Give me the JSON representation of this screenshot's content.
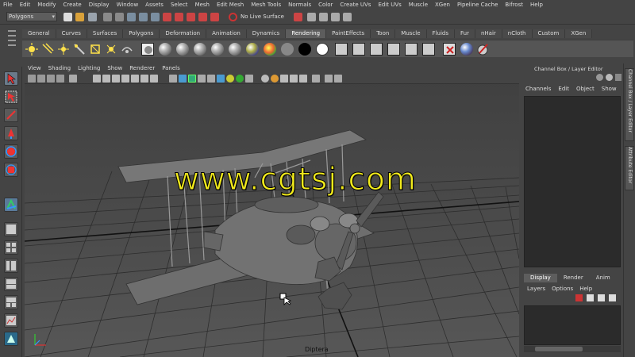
{
  "menu": [
    "File",
    "Edit",
    "Modify",
    "Create",
    "Display",
    "Window",
    "Assets",
    "Select",
    "Mesh",
    "Edit Mesh",
    "Mesh Tools",
    "Normals",
    "Color",
    "Create UVs",
    "Edit UVs",
    "Muscle",
    "XGen",
    "Pipeline Cache",
    "Bifrost",
    "Help"
  ],
  "status": {
    "mode": "Polygons",
    "live_surface": "No Live Surface"
  },
  "shelf": {
    "tabs": [
      "General",
      "Curves",
      "Surfaces",
      "Polygons",
      "Deformation",
      "Animation",
      "Dynamics",
      "Rendering",
      "PaintEffects",
      "Toon",
      "Muscle",
      "Fluids",
      "Fur",
      "nHair",
      "nCloth",
      "Custom",
      "XGen"
    ],
    "active_tab": "Rendering"
  },
  "viewport": {
    "menu": [
      "View",
      "Shading",
      "Lighting",
      "Show",
      "Renderer",
      "Panels"
    ],
    "watermark": "www.cgtsj.com",
    "camera_label": "Diptera"
  },
  "channel_box": {
    "title": "Channel Box / Layer Editor",
    "menus": [
      "Channels",
      "Edit",
      "Object",
      "Show"
    ],
    "layer_tabs": [
      "Display",
      "Render",
      "Anim"
    ],
    "active_layer_tab": "Display",
    "layer_menus": [
      "Layers",
      "Options",
      "Help"
    ]
  },
  "side_tabs": [
    "Channel Box / Layer Editor",
    "Attribute Editor"
  ],
  "colors": {
    "ui_bg": "#444444",
    "watermark": "#f1ea1c",
    "panel_dark": "#2b2b2b"
  }
}
